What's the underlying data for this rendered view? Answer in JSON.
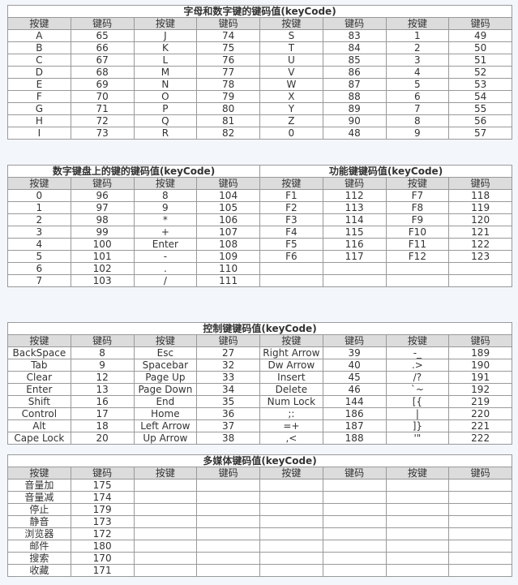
{
  "header_labels": {
    "key": "按键",
    "code": "键码"
  },
  "tables": {
    "letters_digits": {
      "title": "字母和数字键的键码值(keyCode)",
      "rows": [
        [
          "A",
          "65",
          "J",
          "74",
          "S",
          "83",
          "1",
          "49"
        ],
        [
          "B",
          "66",
          "K",
          "75",
          "T",
          "84",
          "2",
          "50"
        ],
        [
          "C",
          "67",
          "L",
          "76",
          "U",
          "85",
          "3",
          "51"
        ],
        [
          "D",
          "68",
          "M",
          "77",
          "V",
          "86",
          "4",
          "52"
        ],
        [
          "E",
          "69",
          "N",
          "78",
          "W",
          "87",
          "5",
          "53"
        ],
        [
          "F",
          "70",
          "O",
          "79",
          "X",
          "88",
          "6",
          "54"
        ],
        [
          "G",
          "71",
          "P",
          "80",
          "Y",
          "89",
          "7",
          "55"
        ],
        [
          "H",
          "72",
          "Q",
          "81",
          "Z",
          "90",
          "8",
          "56"
        ],
        [
          "I",
          "73",
          "R",
          "82",
          "0",
          "48",
          "9",
          "57"
        ]
      ]
    },
    "numpad": {
      "title": "数字键盘上的键的键码值(keyCode)",
      "rows": [
        [
          "0",
          "96",
          "8",
          "104"
        ],
        [
          "1",
          "97",
          "9",
          "105"
        ],
        [
          "2",
          "98",
          "*",
          "106"
        ],
        [
          "3",
          "99",
          "+",
          "107"
        ],
        [
          "4",
          "100",
          "Enter",
          "108"
        ],
        [
          "5",
          "101",
          "-",
          "109"
        ],
        [
          "6",
          "102",
          ".",
          "110"
        ],
        [
          "7",
          "103",
          "/",
          "111"
        ]
      ]
    },
    "function_keys": {
      "title": "功能键键码值(keyCode)",
      "rows": [
        [
          "F1",
          "112",
          "F7",
          "118"
        ],
        [
          "F2",
          "113",
          "F8",
          "119"
        ],
        [
          "F3",
          "114",
          "F9",
          "120"
        ],
        [
          "F4",
          "115",
          "F10",
          "121"
        ],
        [
          "F5",
          "116",
          "F11",
          "122"
        ],
        [
          "F6",
          "117",
          "F12",
          "123"
        ],
        [
          "",
          "",
          "",
          ""
        ],
        [
          "",
          "",
          "",
          ""
        ]
      ]
    },
    "control_keys": {
      "title": "控制键键码值(keyCode)",
      "rows": [
        [
          "BackSpace",
          "8",
          "Esc",
          "27",
          "Right Arrow",
          "39",
          "-_",
          "189"
        ],
        [
          "Tab",
          "9",
          "Spacebar",
          "32",
          "Dw Arrow",
          "40",
          ".>",
          "190"
        ],
        [
          "Clear",
          "12",
          "Page Up",
          "33",
          "Insert",
          "45",
          "/?",
          "191"
        ],
        [
          "Enter",
          "13",
          "Page Down",
          "34",
          "Delete",
          "46",
          "`~",
          "192"
        ],
        [
          "Shift",
          "16",
          "End",
          "35",
          "Num Lock",
          "144",
          "[{",
          "219"
        ],
        [
          "Control",
          "17",
          "Home",
          "36",
          ";:",
          "186",
          "|",
          "220"
        ],
        [
          "Alt",
          "18",
          "Left Arrow",
          "37",
          "=+",
          "187",
          "]}",
          "221"
        ],
        [
          "Cape Lock",
          "20",
          "Up Arrow",
          "38",
          ",<",
          "188",
          "'\"",
          "222"
        ]
      ]
    },
    "multimedia_keys": {
      "title": "多媒体键码值(keyCode)",
      "rows": [
        [
          "音量加",
          "175",
          "",
          "",
          "",
          "",
          "",
          ""
        ],
        [
          "音量减",
          "174",
          "",
          "",
          "",
          "",
          "",
          ""
        ],
        [
          "停止",
          "179",
          "",
          "",
          "",
          "",
          "",
          ""
        ],
        [
          "静音",
          "173",
          "",
          "",
          "",
          "",
          "",
          ""
        ],
        [
          "浏览器",
          "172",
          "",
          "",
          "",
          "",
          "",
          ""
        ],
        [
          "邮件",
          "180",
          "",
          "",
          "",
          "",
          "",
          ""
        ],
        [
          "搜索",
          "170",
          "",
          "",
          "",
          "",
          "",
          ""
        ],
        [
          "收藏",
          "171",
          "",
          "",
          "",
          "",
          "",
          ""
        ]
      ]
    }
  }
}
